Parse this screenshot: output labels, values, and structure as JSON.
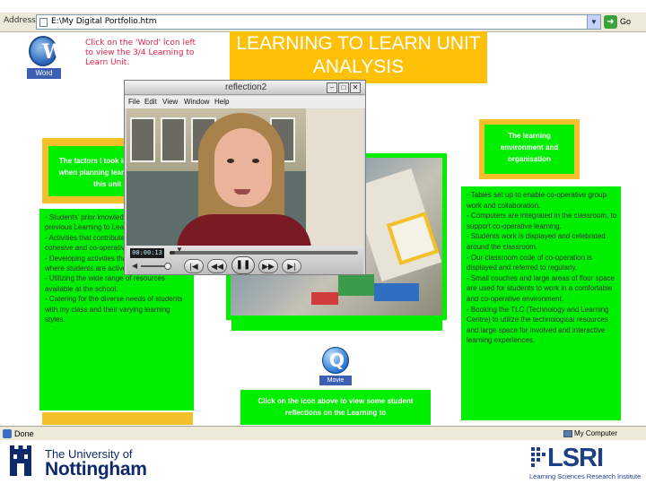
{
  "browser": {
    "address_label": "Address",
    "address_value": "E:\\My Digital Portfolio.htm",
    "go_label": "Go",
    "status_text": "Done",
    "zone_text": "My Computer"
  },
  "word_link": {
    "icon_label": "Word",
    "instruction": "Click on the 'Word' icon left to view the 3/4 Learning to Learn Unit."
  },
  "title": "LEARNING TO LEARN UNIT ANALYSIS",
  "left_heading": "The factors I took into consideration when planning learning activities for this unit of work",
  "left_list": "- Students' prior knowledge during the previous Learning to Learn unit.\n- Activities that contribute to developing a cohesive and co-operative classroom.\n- Developing activities that are hands on where students are actively engaged.\n- Utilizing the wide range of resources available at the school.\n- Catering for the diverse needs of students with my class and their varying learning styles.",
  "right_heading": "The learning environment and organisation",
  "right_list": "- Tables set up to enable co-operative group work and collaboration.\n- Computers are integrated in the classroom, to support co-operative learning.\n- Students work is displayed and celebrated around the classroom.\n- Our classroom code of co-operation is displayed and referred to regularly.\n- Small couches and large areas of floor space are used for students to work in a comfortable and co-operative environment.\n- Booking the TLC (Technology and Learning Centre) to utilize the technological resources and large space for involved and interactive learning experiences.",
  "movie_link": {
    "icon_label": "Movie",
    "instruction": "Click on the icon above to view some student reflections on the Learning to"
  },
  "quicktime": {
    "title": "reflection2",
    "menu": [
      "File",
      "Edit",
      "View",
      "Window",
      "Help"
    ],
    "timecode": "00:00:13",
    "progress": 0.03
  },
  "footer": {
    "uni_line1": "The University of",
    "uni_line2": "Nottingham",
    "lsri": "LSRI",
    "lsri_sub": "Learning Sciences Research Institute"
  },
  "colors": {
    "green": "#00ee00",
    "yellow": "#f3c02a",
    "title_bg": "#ffc107",
    "instruction_red": "#e0204a"
  }
}
